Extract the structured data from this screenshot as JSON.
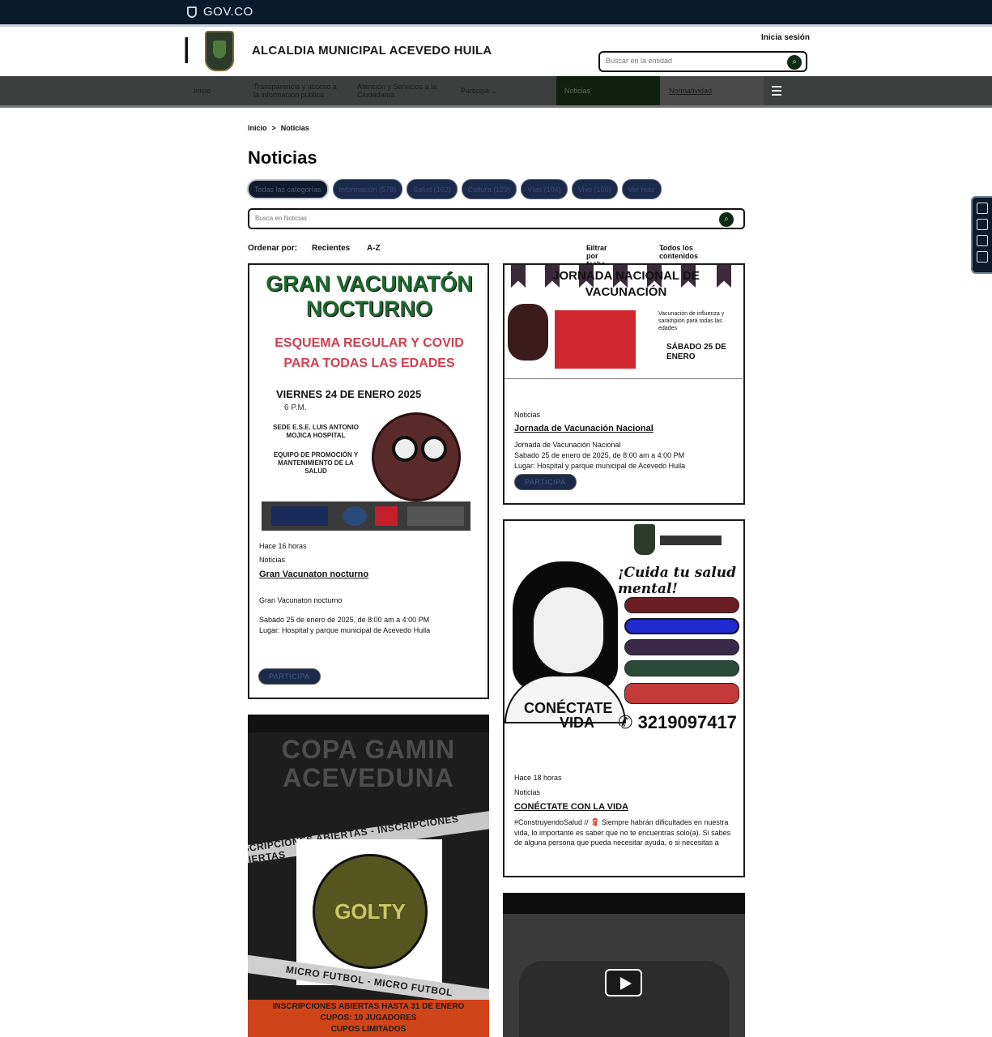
{
  "govbar": {
    "logo_text": "GOV.CO"
  },
  "header": {
    "entity_name": "ALCALDIA MUNICIPAL ACEVEDO HUILA",
    "login_label": "Inicia sesión",
    "search_placeholder": "Buscar en la entidad"
  },
  "nav": {
    "items": [
      "Inicio",
      "Transparencia y acceso a la información pública",
      "Atención y Servicios a la Ciudadanía",
      "Participa",
      "Noticias",
      "Normatividad"
    ]
  },
  "breadcrumb": {
    "home": "Inicio",
    "separator": ">",
    "current": "Noticias"
  },
  "page_title": "Noticias",
  "filters": {
    "chips": [
      "Todas las categorías",
      "Información (578)",
      "Salud (162)",
      "Cultura (129)",
      "Vías (104)",
      "Vivo (100)",
      "Ver más"
    ],
    "search_placeholder": "Busca en Noticias"
  },
  "sort": {
    "label": "Ordenar por:",
    "options": [
      "Recientes",
      "A-Z"
    ],
    "date_filter": "Filtrar por fecha",
    "content_filter": "Todos los contenidos"
  },
  "cards": [
    {
      "poster": {
        "title": "GRAN VACUNATÓN NOCTURNO",
        "subtitle": "ESQUEMA REGULAR Y COVID PARA TODAS LAS EDADES",
        "date": "VIERNES 24 DE ENERO 2025",
        "hour": "6 P.M.",
        "place": "SEDE E.S.E. LUIS ANTONIO MOJICA HOSPITAL",
        "team": "EQUIPO DE PROMOCIÓN Y MANTENIMIENTO DE LA SALUD"
      },
      "time": "Hace 16 horas",
      "category": "Noticias",
      "title": "Gran Vacunaton nocturno",
      "desc1": "Gran Vacunaton nocturno",
      "desc2": "Sabado 25 de enero de 2025, de 8:00 am a 4:00 PM",
      "desc3": "Lugar: Hospital y parque municipal de Acevedo Huila",
      "button": "PARTICIPA"
    },
    {
      "poster": {
        "title": "JORNADA NACIONAL DE VACUNACIÓN",
        "side_text": "Vacunación de influenza y sarampión para todas las edades",
        "date": "SÁBADO 25 DE ENERO"
      },
      "category": "Noticias",
      "title": "Jornada de Vacunación Nacional",
      "desc1": "Jornada de Vacunación Nacional",
      "desc2": "Sabado 25 de enero de 2025, de 8:00 am a 4:00 PM",
      "desc3": "Lugar: Hospital y parque municipal de Acevedo Huila",
      "button": "PARTICIPA"
    },
    {
      "poster": {
        "script": "¡Cuida tu salud mental!",
        "connect": "CONÉCTATE",
        "life": "VIDA",
        "phone": "3219097417"
      },
      "time": "Hace 18 horas",
      "category": "Noticias",
      "title": "CONÉCTATE CON LA VIDA",
      "desc": "#ConstruyendoSalud // 🧣 Siempre habrán dificultades en nuestra vida, lo importante es saber que no te encuentras solo(a). Si sabes de alguna persona que pueda necesitar ayuda, o si necesitas a"
    },
    {
      "poster": {
        "title": "COPA GAMIN ACEVEDUNA",
        "band": "INSCRIPCIONES ABIERTAS - INSCRIPCIONES ABIERTAS",
        "ball_brand": "GOLTY",
        "sport": "MICRO FUTBOL - MICRO FUTBOL",
        "foot1": "INSCRIPCIONES ABIERTAS HASTA 31 DE ENERO",
        "foot2": "CUPOS: 10 JUGADORES",
        "foot3": "CUPOS LIMITADOS"
      }
    }
  ],
  "colors": {
    "govbar": "#0a1a2d",
    "nav": "#3d3f3f",
    "accent_dark": "#1b2a4a"
  }
}
